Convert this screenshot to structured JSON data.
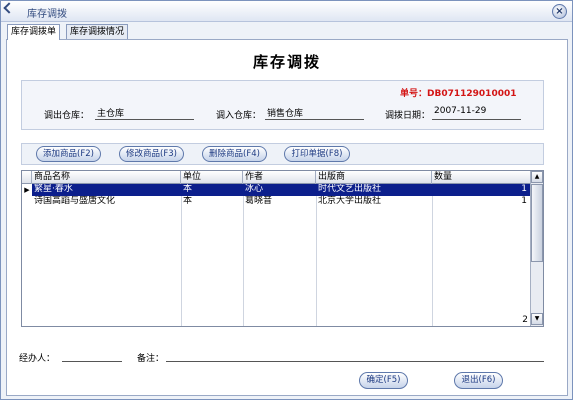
{
  "window": {
    "title": "库存调拨",
    "close_symbol": "×"
  },
  "tabs": [
    {
      "label": "库存调拨单",
      "active": true
    },
    {
      "label": "库存调拨情况",
      "active": false
    }
  ],
  "form": {
    "title": "库存调拨",
    "doc_number_label": "单号：",
    "doc_number": "DB071129010001",
    "fields": {
      "out_warehouse_label": "调出仓库：",
      "out_warehouse": "主仓库",
      "in_warehouse_label": "调入仓库：",
      "in_warehouse": "销售仓库",
      "date_label": "调拨日期：",
      "date": "2007-11-29"
    }
  },
  "toolbar": {
    "add_label": "添加商品(F2)",
    "edit_label": "修改商品(F3)",
    "delete_label": "删除商品(F4)",
    "print_label": "打印单据(F8)"
  },
  "grid": {
    "columns": [
      "商品名称",
      "单位",
      "作者",
      "出版商",
      "数量"
    ],
    "rows": [
      [
        "繁星·春水",
        "本",
        "冰心",
        "时代文艺出版社",
        "1"
      ],
      [
        "诗国高蹈与盛唐文化",
        "本",
        "葛晓音",
        "北京大学出版社",
        "1"
      ]
    ],
    "selected_row": 0,
    "row_indicator": "▶",
    "footer_total": "2"
  },
  "bottom": {
    "handler_label": "经办人：",
    "handler_value": "",
    "remarks_label": "备注：",
    "remarks_value": ""
  },
  "actions": {
    "ok_label": "确定(F5)",
    "exit_label": "退出(F6)"
  },
  "colors": {
    "doc_number": "#d31414",
    "selected_row": "#0c1f8c",
    "button_text": "#1d3a82"
  }
}
